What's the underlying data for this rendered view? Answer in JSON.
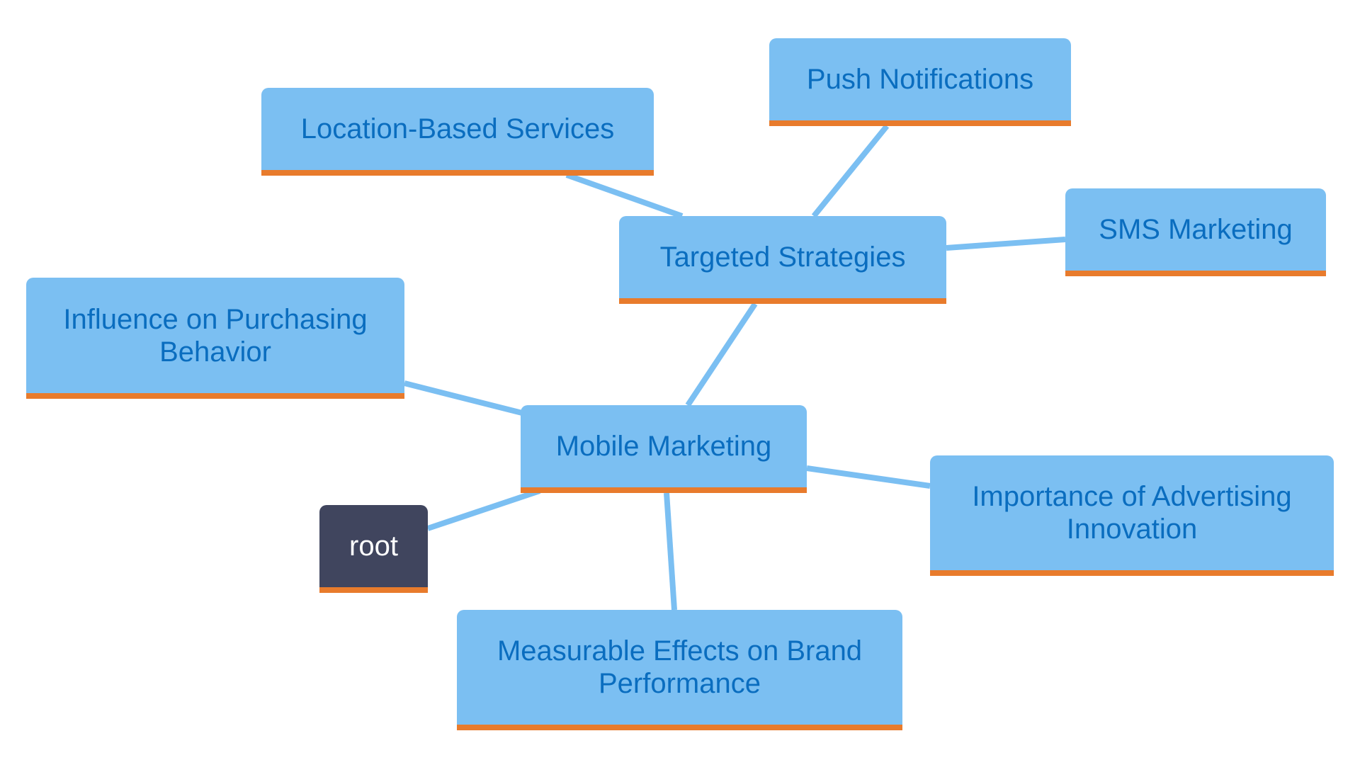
{
  "diagram": {
    "type": "mindmap",
    "colors": {
      "node_fill": "#7bbff2",
      "node_text": "#0a6dbf",
      "node_underline": "#e87b2c",
      "root_fill": "#40455e",
      "root_text": "#ffffff",
      "edge": "#7bbff2"
    },
    "nodes": [
      {
        "id": "root",
        "label": "root"
      },
      {
        "id": "mobile",
        "label": "Mobile Marketing"
      },
      {
        "id": "targeted",
        "label": "Targeted Strategies"
      },
      {
        "id": "push",
        "label": "Push Notifications"
      },
      {
        "id": "location",
        "label": "Location-Based Services"
      },
      {
        "id": "sms",
        "label": "SMS Marketing"
      },
      {
        "id": "influence",
        "label": "Influence on Purchasing Behavior"
      },
      {
        "id": "importance",
        "label": "Importance of Advertising Innovation"
      },
      {
        "id": "measurable",
        "label": "Measurable Effects on Brand Performance"
      }
    ],
    "edges": [
      {
        "from": "root",
        "to": "mobile"
      },
      {
        "from": "mobile",
        "to": "targeted"
      },
      {
        "from": "mobile",
        "to": "influence"
      },
      {
        "from": "mobile",
        "to": "importance"
      },
      {
        "from": "mobile",
        "to": "measurable"
      },
      {
        "from": "targeted",
        "to": "push"
      },
      {
        "from": "targeted",
        "to": "location"
      },
      {
        "from": "targeted",
        "to": "sms"
      }
    ]
  }
}
